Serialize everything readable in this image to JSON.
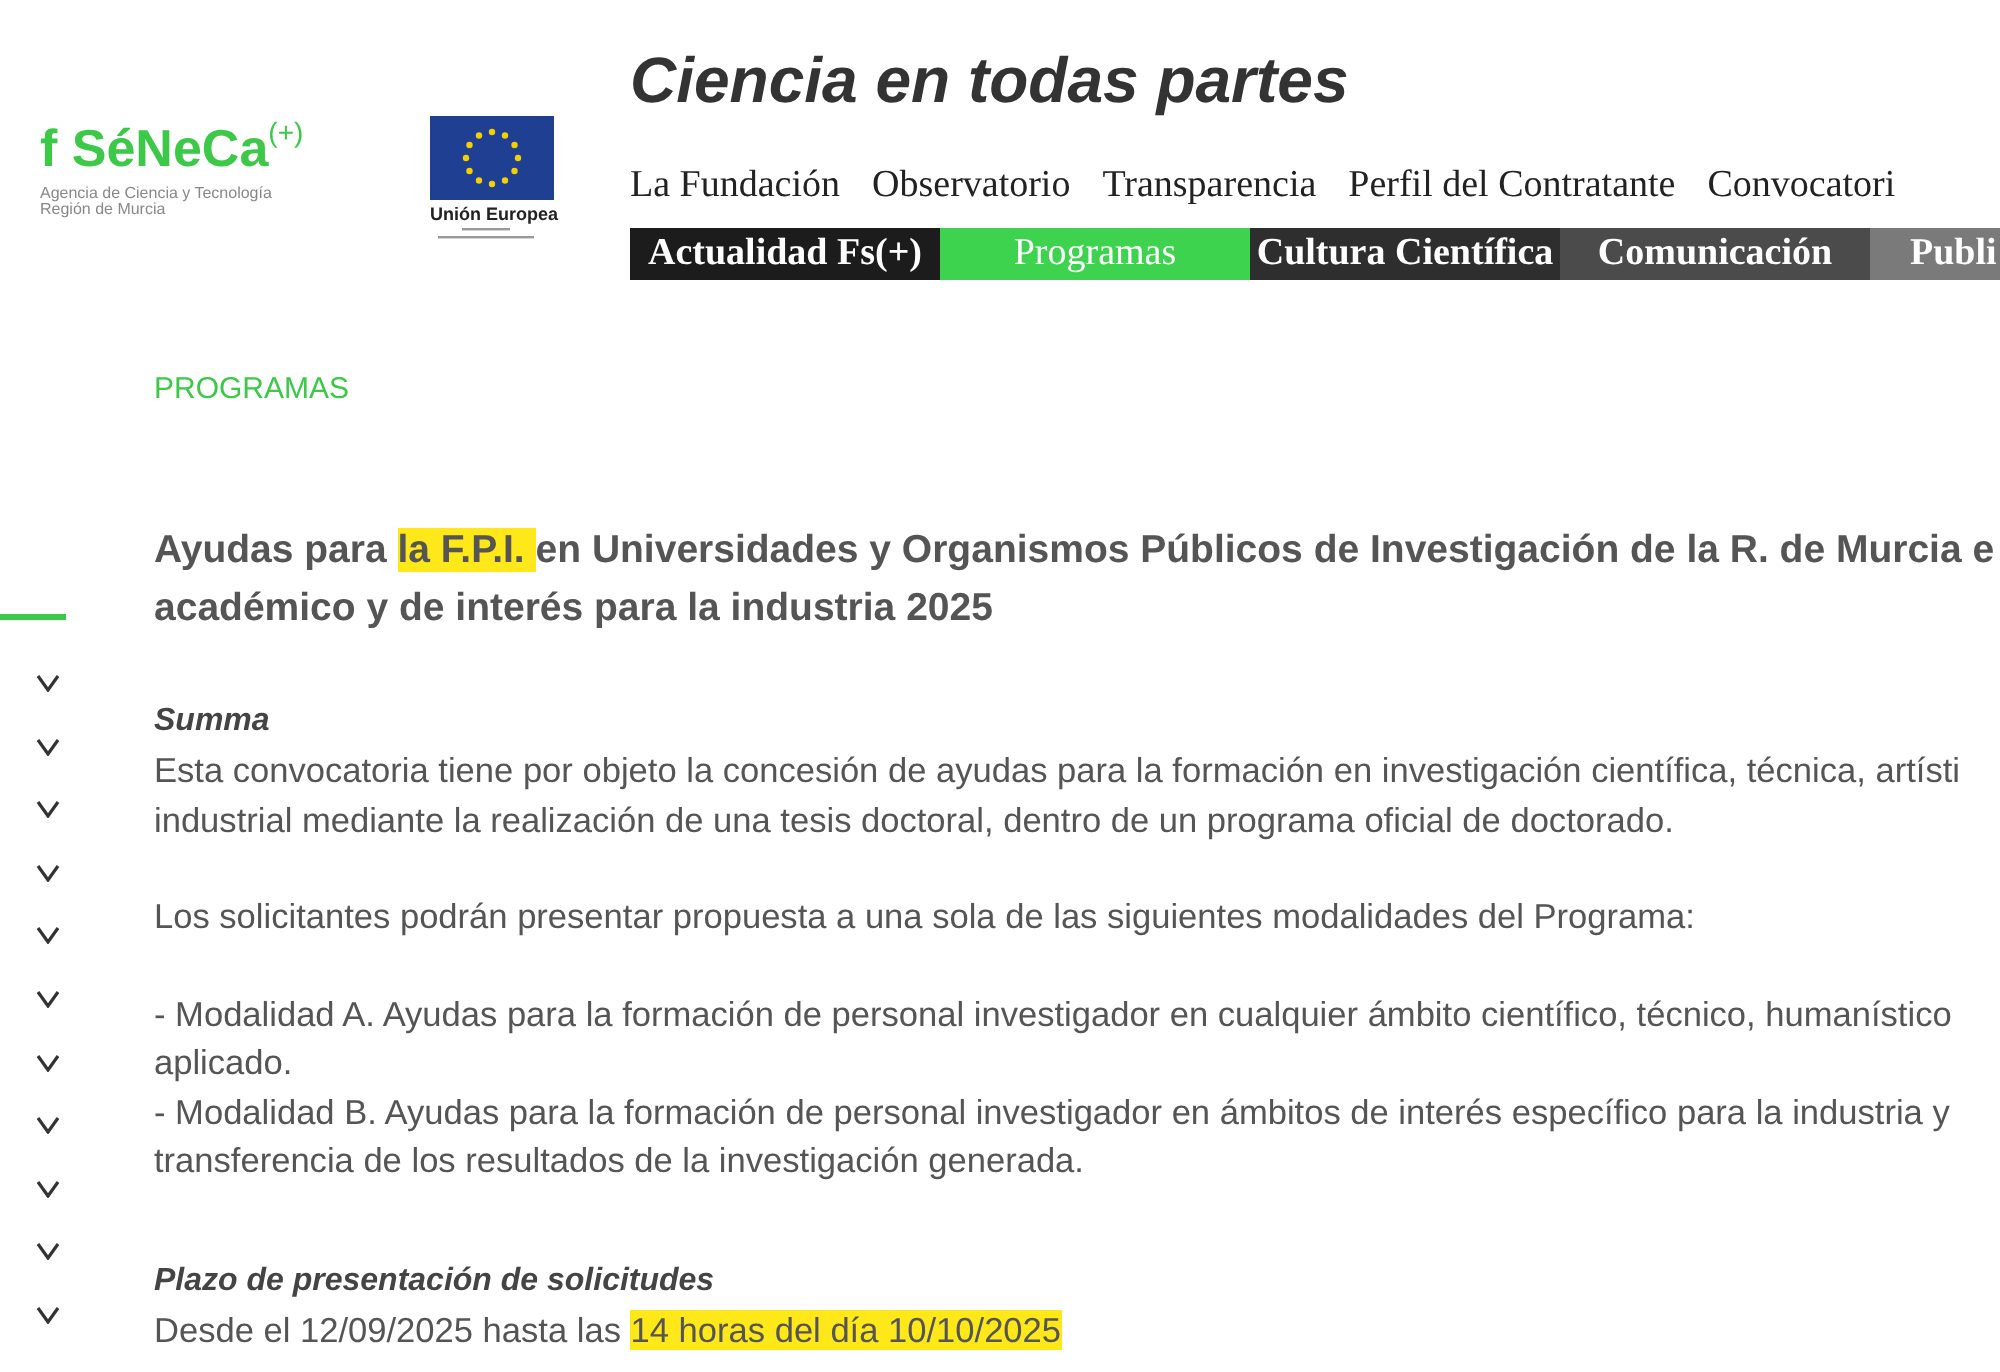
{
  "logo": {
    "name": "f SéNeCa$^{(+)}$",
    "subtitle": [
      "Agencia de Ciencia y Tecnología",
      "Región de Murcia"
    ]
  },
  "eu_logo": {
    "label": "Unión Europea"
  },
  "site_title": "Ciencia en todas partes",
  "top_menu": [
    "La Fundación",
    "Observatorio",
    "Transparencia",
    "Perfil del Contratante",
    "Convocatori"
  ],
  "section_tabs": [
    {
      "label": "Actualidad Fs(+)",
      "selected": false,
      "color": "#1c1c1c"
    },
    {
      "label": "Programas",
      "selected": true,
      "color": "#3dd34f"
    },
    {
      "label": "Cultura Científica",
      "selected": false,
      "color": "#2e2e2e"
    },
    {
      "label": "Comunicación",
      "selected": false,
      "color": "#4b4b4b"
    },
    {
      "label": "Publi",
      "selected": false,
      "color": "#7a7a7a"
    }
  ],
  "breadcrumb": "PROGRAMAS",
  "title_lines": [
    [
      {
        "text": "Ayudas para ",
        "highlight": false
      },
      {
        "text": "la F.P.I. ",
        "highlight": true
      },
      {
        "text": "en Universidades y Organismos Públicos de Investigación de la R. de Murcia e",
        "highlight": false
      }
    ],
    [
      {
        "text": "académico y de interés para la industria 2025",
        "highlight": false
      }
    ]
  ],
  "sections": [
    {
      "heading": "Summa",
      "paragraphs": [
        [
          [
            {
              "text": "Esta convocatoria tiene por objeto la concesión de ayudas para la formación en investigación científica, técnica, artísti",
              "highlight": false
            }
          ],
          [
            {
              "text": "industrial mediante la realización de una tesis doctoral, dentro de un programa oficial de doctorado.",
              "highlight": false
            }
          ]
        ],
        [
          [
            {
              "text": "Los solicitantes podrán presentar propuesta a una sola de las siguientes modalidades del Programa:",
              "highlight": false
            }
          ]
        ],
        [
          [
            {
              "text": "- Modalidad A. Ayudas para la formación de personal investigador en cualquier ámbito científico, técnico, humanístico",
              "highlight": false
            }
          ],
          [
            {
              "text": "aplicado.",
              "highlight": false
            }
          ],
          [
            {
              "text": "- Modalidad B. Ayudas para la formación de personal investigador en ámbitos de interés específico para la industria y",
              "highlight": false
            }
          ],
          [
            {
              "text": "transferencia de los resultados de la investigación generada.",
              "highlight": false
            }
          ]
        ]
      ]
    },
    {
      "heading": "Plazo de presentación de solicitudes",
      "paragraphs": [
        [
          [
            {
              "text": "Desde el 12/09/2025 hasta las ",
              "highlight": false
            },
            {
              "text": "14 horas del día 10/10/2025",
              "highlight": true
            }
          ]
        ]
      ]
    }
  ]
}
